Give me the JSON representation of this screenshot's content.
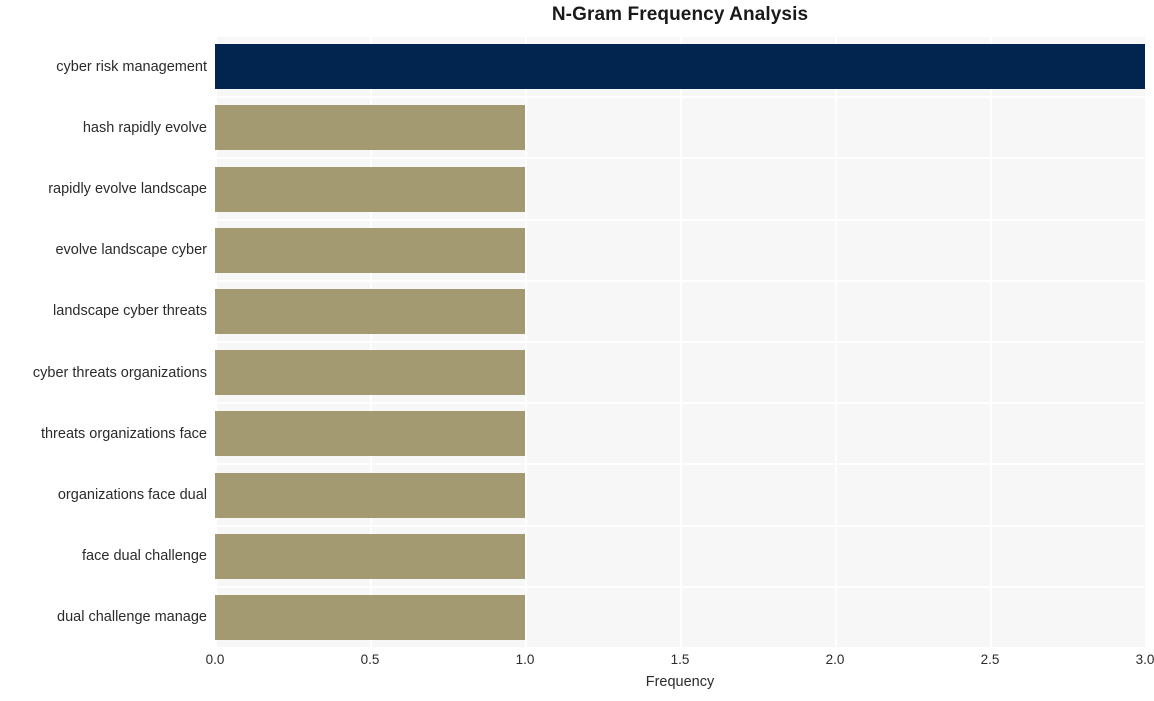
{
  "chart_data": {
    "type": "bar",
    "orientation": "horizontal",
    "title": "N-Gram Frequency Analysis",
    "xlabel": "Frequency",
    "ylabel": "",
    "xlim": [
      0.0,
      3.0
    ],
    "xticks": [
      "0.0",
      "0.5",
      "1.0",
      "1.5",
      "2.0",
      "2.5",
      "3.0"
    ],
    "xtick_values": [
      0.0,
      0.5,
      1.0,
      1.5,
      2.0,
      2.5,
      3.0
    ],
    "grid": true,
    "legend": "none",
    "categories": [
      "cyber risk management",
      "hash rapidly evolve",
      "rapidly evolve landscape",
      "evolve landscape cyber",
      "landscape cyber threats",
      "cyber threats organizations",
      "threats organizations face",
      "organizations face dual",
      "face dual challenge",
      "dual challenge manage"
    ],
    "values": [
      3,
      1,
      1,
      1,
      1,
      1,
      1,
      1,
      1,
      1
    ],
    "bar_colors": [
      "#02254f",
      "#a49a72",
      "#a49a72",
      "#a49a72",
      "#a49a72",
      "#a49a72",
      "#a49a72",
      "#a49a72",
      "#a49a72",
      "#a49a72"
    ]
  },
  "style": {
    "plot_background": "#f7f7f7",
    "figure_background": "#ffffff",
    "grid_color": "#ffffff",
    "highlight_color": "#02254f",
    "bar_color": "#a49a72",
    "text_color": "#2b2b2b",
    "title_color": "#1a1a1a"
  }
}
